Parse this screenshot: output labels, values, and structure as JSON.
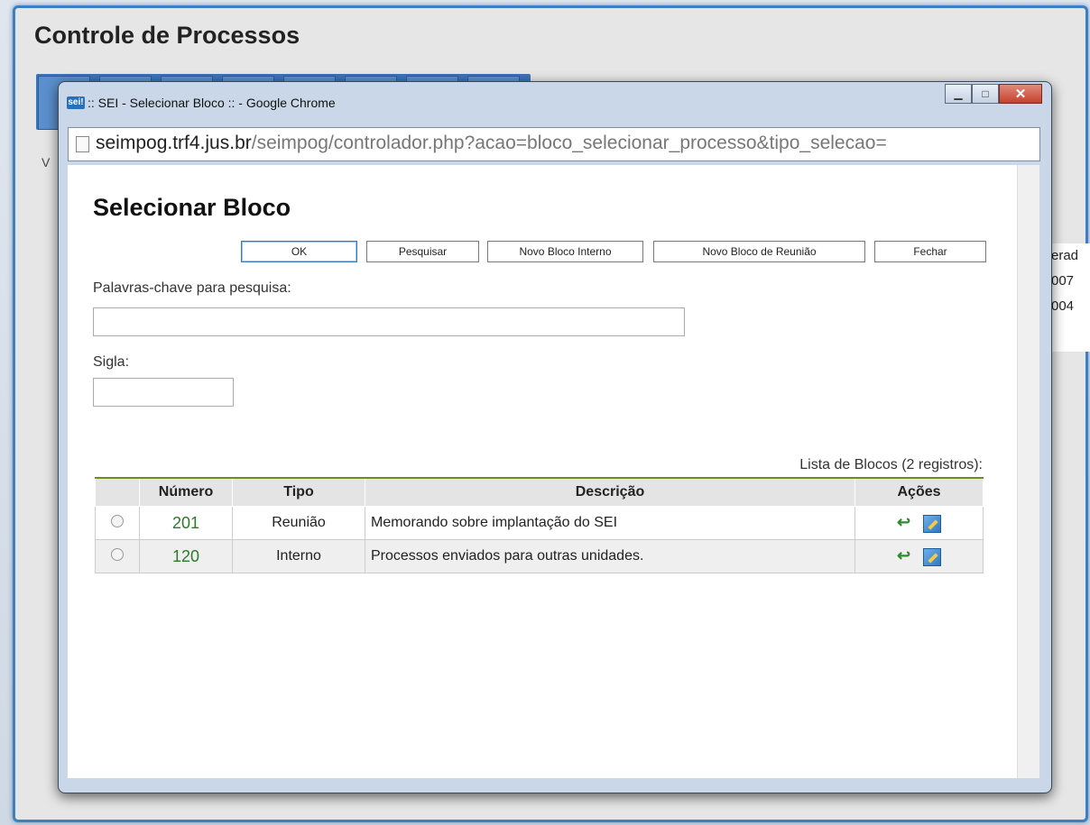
{
  "background": {
    "title": "Controle de Processos",
    "side_text": "V",
    "right_col_header": "erad",
    "right_col_values": [
      "007",
      "004"
    ]
  },
  "window": {
    "favicon": "sei!",
    "title": ":: SEI - Selecionar Bloco :: - Google Chrome",
    "controls": [
      "minimize",
      "maximize",
      "close"
    ],
    "address": {
      "host": "seimpog.trf4.jus.br",
      "path": "/seimpog/controlador.php?acao=bloco_selecionar_processo&tipo_selecao="
    }
  },
  "page": {
    "heading": "Selecionar Bloco",
    "buttons": {
      "ok": "OK",
      "pesquisar": "Pesquisar",
      "novo_interno": "Novo Bloco Interno",
      "novo_reuniao": "Novo Bloco de Reunião",
      "fechar": "Fechar"
    },
    "keywords_label": "Palavras-chave para pesquisa:",
    "keywords_value": "",
    "sigla_label": "Sigla:",
    "sigla_value": "",
    "list_caption": "Lista de Blocos (2 registros):",
    "table": {
      "headers": [
        "",
        "Número",
        "Tipo",
        "Descrição",
        "Ações"
      ],
      "rows": [
        {
          "numero": "201",
          "tipo": "Reunião",
          "descricao": "Memorando sobre implantação do SEI"
        },
        {
          "numero": "120",
          "tipo": "Interno",
          "descricao": "Processos enviados para outras unidades."
        }
      ]
    }
  },
  "icons": [
    "page-icon",
    "back-arrow-icon",
    "edit-icon",
    "radio-icon"
  ],
  "colors": {
    "accent": "#3a78c0",
    "number_green": "#2c7a2c",
    "header_rule": "#6b8e23"
  }
}
